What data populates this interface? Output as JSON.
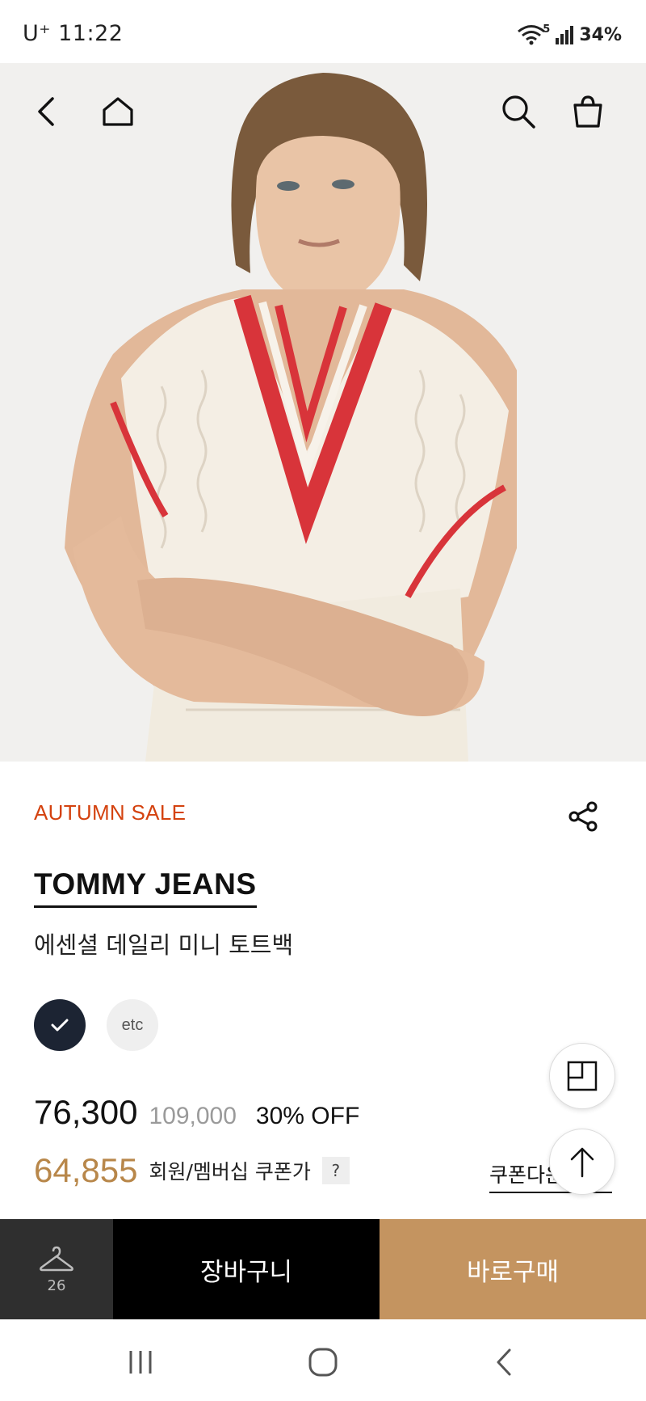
{
  "status_bar": {
    "carrier": "U⁺",
    "time": "11:22",
    "network": "5",
    "battery": "34%"
  },
  "nav": {
    "icons": [
      "back-icon",
      "home-icon",
      "search-icon",
      "shopping-bag-icon"
    ]
  },
  "product": {
    "sale_tag": "AUTUMN SALE",
    "brand": "TOMMY JEANS",
    "name": "에센셜 데일리 미니 토트백",
    "swatches": {
      "selected_color": "#1c2433",
      "etc_label": "etc"
    },
    "price": "76,300",
    "original_price": "109,000",
    "discount": "30% OFF",
    "coupon_price": "64,855",
    "coupon_label": "회원/멤버십 쿠폰가",
    "help": "?",
    "coupon_link": "쿠폰다운로드"
  },
  "action_bar": {
    "wish_count": "26",
    "cart_label": "장바구니",
    "buy_label": "바로구매"
  },
  "colors": {
    "sale": "#d4420f",
    "coupon": "#b8874a",
    "buy_button": "#c49460",
    "cart_button": "#000000",
    "wish_button": "#2f2f2f"
  }
}
